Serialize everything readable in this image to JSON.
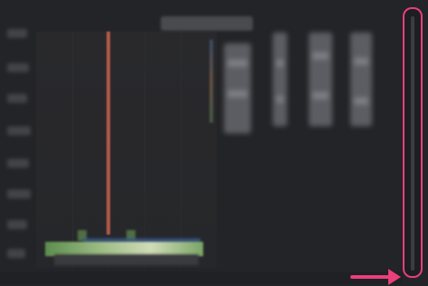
{
  "colors": {
    "background": "#232427",
    "highlight": "#e4407a",
    "series_red": "#b45a48",
    "series_green": "#9aba82",
    "series_blue": "#39598a"
  },
  "icons": {
    "annotation_arrow": "arrow-right-icon"
  },
  "scrollbar": {
    "orientation": "vertical",
    "highlighted": true
  }
}
